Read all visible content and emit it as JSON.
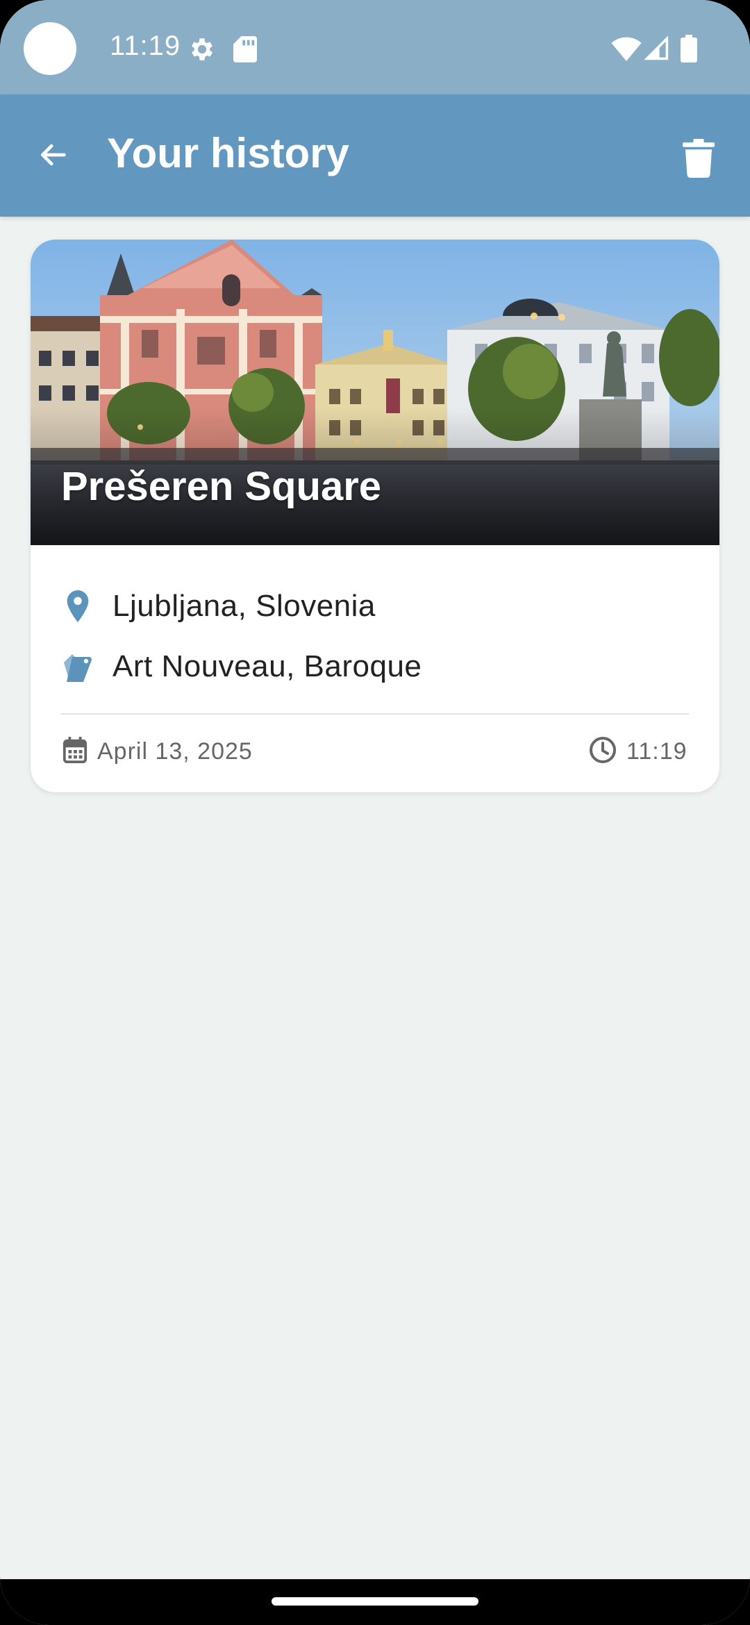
{
  "status_bar": {
    "time": "11:19",
    "icons": [
      "settings-gear-icon",
      "sd-card-icon",
      "wifi-icon",
      "cell-signal-icon",
      "battery-icon"
    ]
  },
  "app_bar": {
    "title": "Your history",
    "back_icon": "arrow-back-icon",
    "delete_icon": "trash-icon"
  },
  "history": [
    {
      "title": "Prešeren Square",
      "location": "Ljubljana, Slovenia",
      "styles": "Art Nouveau, Baroque",
      "date": "April 13, 2025",
      "time": "11:19"
    }
  ],
  "colors": {
    "status_bar": "#8aaec5",
    "app_bar": "#6298bf",
    "accent": "#5b93bb",
    "background": "#eef3f2"
  }
}
